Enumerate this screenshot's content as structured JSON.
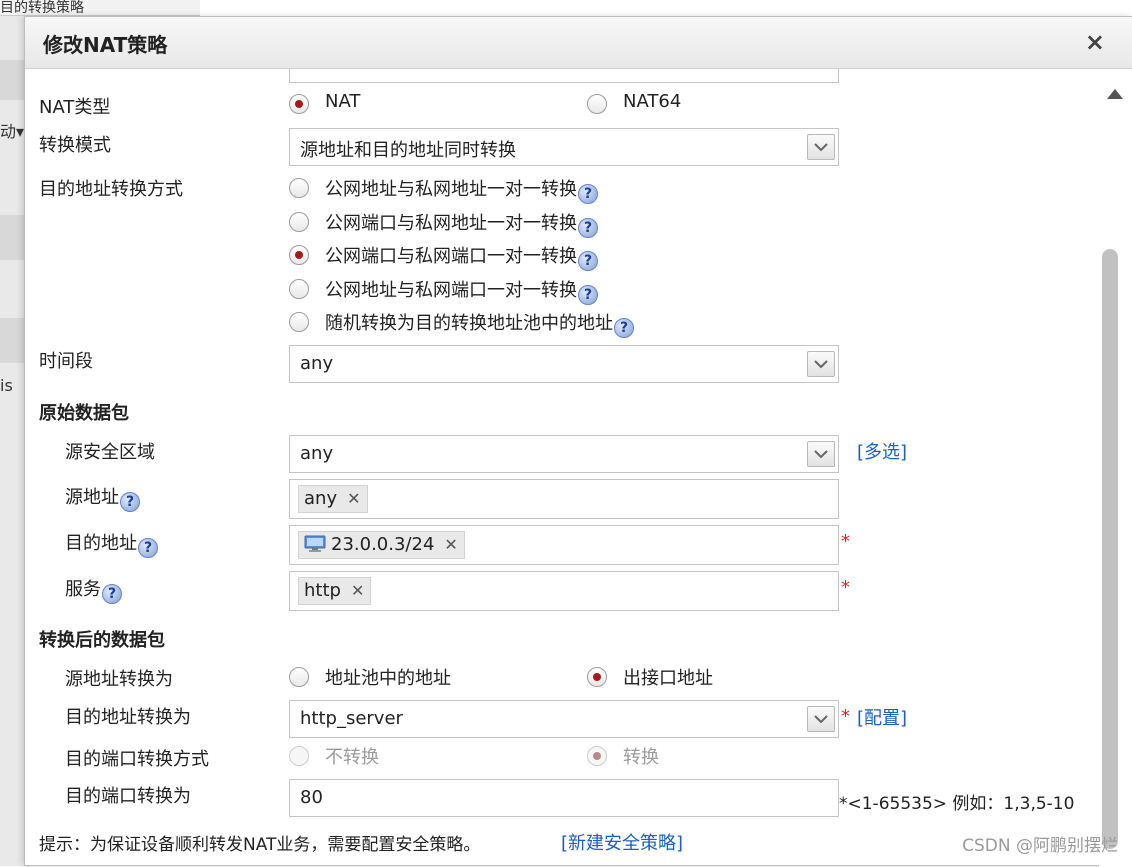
{
  "background": {
    "tab_text": "目的转换策略",
    "side_text_1": "动▾",
    "side_text_2": "is"
  },
  "dialog": {
    "title": "修改NAT策略",
    "close_label": "×"
  },
  "form": {
    "nat_type": {
      "label": "NAT类型",
      "options": [
        "NAT",
        "NAT64"
      ],
      "selected": "NAT"
    },
    "convert_mode": {
      "label": "转换模式",
      "value": "源地址和目的地址同时转换"
    },
    "dst_convert_method": {
      "label": "目的地址转换方式",
      "options": [
        "公网地址与私网地址一对一转换",
        "公网端口与私网地址一对一转换",
        "公网端口与私网端口一对一转换",
        "公网地址与私网端口一对一转换",
        "随机转换为目的转换地址池中的地址"
      ],
      "selected_index": 2
    },
    "time_range": {
      "label": "时间段",
      "value": "any"
    },
    "original_packet": {
      "heading": "原始数据包",
      "src_zone": {
        "label": "源安全区域",
        "value": "any",
        "multi_link": "[多选]"
      },
      "src_addr": {
        "label": "源地址",
        "tags": [
          "any"
        ]
      },
      "dst_addr": {
        "label": "目的地址",
        "tags": [
          "23.0.0.3/24"
        ],
        "required": "*"
      },
      "service": {
        "label": "服务",
        "tags": [
          "http"
        ],
        "required": "*"
      }
    },
    "translated_packet": {
      "heading": "转换后的数据包",
      "src_convert": {
        "label": "源地址转换为",
        "options": [
          "地址池中的地址",
          "出接口地址"
        ],
        "selected": "出接口地址"
      },
      "dst_convert": {
        "label": "目的地址转换为",
        "value": "http_server",
        "required": "*",
        "config_link": "[配置]"
      },
      "port_method": {
        "label": "目的端口转换方式",
        "options": [
          "不转换",
          "转换"
        ],
        "selected": "转换"
      },
      "port_value": {
        "label": "目的端口转换为",
        "value": "80",
        "hint": "*<1-65535> 例如：1,3,5-10"
      }
    },
    "tip": {
      "text": "提示：为保证设备顺利转发NAT业务，需要配置安全策略。",
      "link": "[新建安全策略]"
    }
  },
  "watermark": "CSDN @阿鹏别摆烂",
  "colors": {
    "radio_selected": "#a81a1a",
    "link": "#1a5fc4",
    "required": "#dd2222"
  }
}
